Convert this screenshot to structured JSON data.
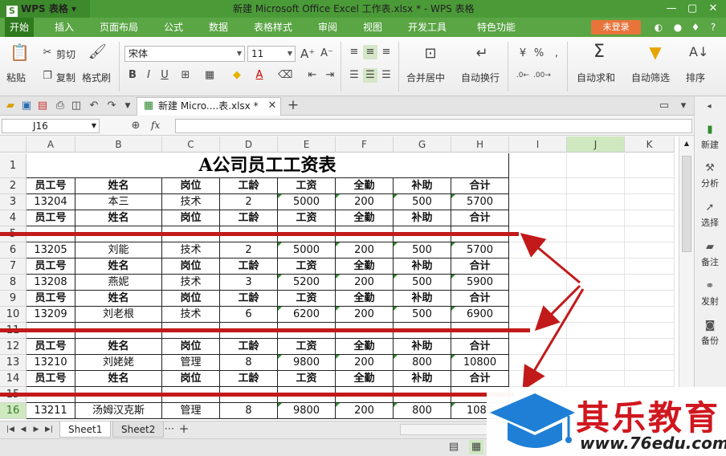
{
  "app": {
    "logo": "WPS 表格",
    "title": "新建 Microsoft Office Excel 工作表.xlsx * - WPS 表格"
  },
  "menu": {
    "items": [
      "开始",
      "插入",
      "页面布局",
      "公式",
      "数据",
      "表格样式",
      "审阅",
      "视图",
      "开发工具",
      "特色功能"
    ],
    "login": "未登录"
  },
  "ribbon": {
    "paste": "粘贴",
    "cut": "剪切",
    "copy": "复制",
    "format_painter": "格式刷",
    "font_name": "宋体",
    "font_size": "11",
    "bold": "B",
    "italic": "I",
    "underline": "U",
    "merge_center": "合并居中",
    "wrap_text": "自动换行",
    "percent": "%",
    "auto_sum": "自动求和",
    "auto_filter": "自动筛选",
    "sort": "排序"
  },
  "doc_tab": {
    "label": "新建 Micro....表.xlsx *"
  },
  "formula_bar": {
    "name_box": "J16",
    "fx": "fx",
    "content": ""
  },
  "columns": [
    "A",
    "B",
    "C",
    "D",
    "E",
    "F",
    "G",
    "H",
    "I",
    "J",
    "K"
  ],
  "selected_column": "J",
  "selected_row": "16",
  "rows": [
    {
      "num": "1",
      "type": "title",
      "title": "A公司员工工资表"
    },
    {
      "num": "2",
      "type": "header",
      "cells": [
        "员工号",
        "姓名",
        "岗位",
        "工龄",
        "工资",
        "全勤",
        "补助",
        "合计"
      ]
    },
    {
      "num": "3",
      "type": "data",
      "cells": [
        "13204",
        "本三",
        "技术",
        "2",
        "5000",
        "200",
        "500",
        "5700"
      ]
    },
    {
      "num": "4",
      "type": "header",
      "cells": [
        "员工号",
        "姓名",
        "岗位",
        "工龄",
        "工资",
        "全勤",
        "补助",
        "合计"
      ]
    },
    {
      "num": "5",
      "type": "blank"
    },
    {
      "num": "6",
      "type": "data",
      "cells": [
        "13205",
        "刘能",
        "技术",
        "2",
        "5000",
        "200",
        "500",
        "5700"
      ]
    },
    {
      "num": "7",
      "type": "header",
      "cells": [
        "员工号",
        "姓名",
        "岗位",
        "工龄",
        "工资",
        "全勤",
        "补助",
        "合计"
      ]
    },
    {
      "num": "8",
      "type": "data",
      "cells": [
        "13208",
        "燕妮",
        "技术",
        "3",
        "5200",
        "200",
        "500",
        "5900"
      ]
    },
    {
      "num": "9",
      "type": "header",
      "cells": [
        "员工号",
        "姓名",
        "岗位",
        "工龄",
        "工资",
        "全勤",
        "补助",
        "合计"
      ]
    },
    {
      "num": "10",
      "type": "data",
      "cells": [
        "13209",
        "刘老根",
        "技术",
        "6",
        "6200",
        "200",
        "500",
        "6900"
      ]
    },
    {
      "num": "11",
      "type": "blank"
    },
    {
      "num": "12",
      "type": "header",
      "cells": [
        "员工号",
        "姓名",
        "岗位",
        "工龄",
        "工资",
        "全勤",
        "补助",
        "合计"
      ]
    },
    {
      "num": "13",
      "type": "data",
      "cells": [
        "13210",
        "刘姥姥",
        "管理",
        "8",
        "9800",
        "200",
        "800",
        "10800"
      ]
    },
    {
      "num": "14",
      "type": "header",
      "cells": [
        "员工号",
        "姓名",
        "岗位",
        "工龄",
        "工资",
        "全勤",
        "补助",
        "合计"
      ]
    },
    {
      "num": "15",
      "type": "blank"
    },
    {
      "num": "16",
      "type": "data",
      "cells": [
        "13211",
        "汤姆汉克斯",
        "管理",
        "8",
        "9800",
        "200",
        "800",
        "1080"
      ]
    }
  ],
  "sidebar": {
    "items": [
      "新建",
      "分析",
      "选择",
      "备注",
      "发射",
      "备份"
    ]
  },
  "sheets": [
    "Sheet1",
    "Sheet2"
  ],
  "watermark": {
    "name": "其乐教育",
    "url": "www.76edu.com"
  },
  "colors": {
    "accent": "#4b9a38",
    "annotation_red": "#c21a1a"
  }
}
